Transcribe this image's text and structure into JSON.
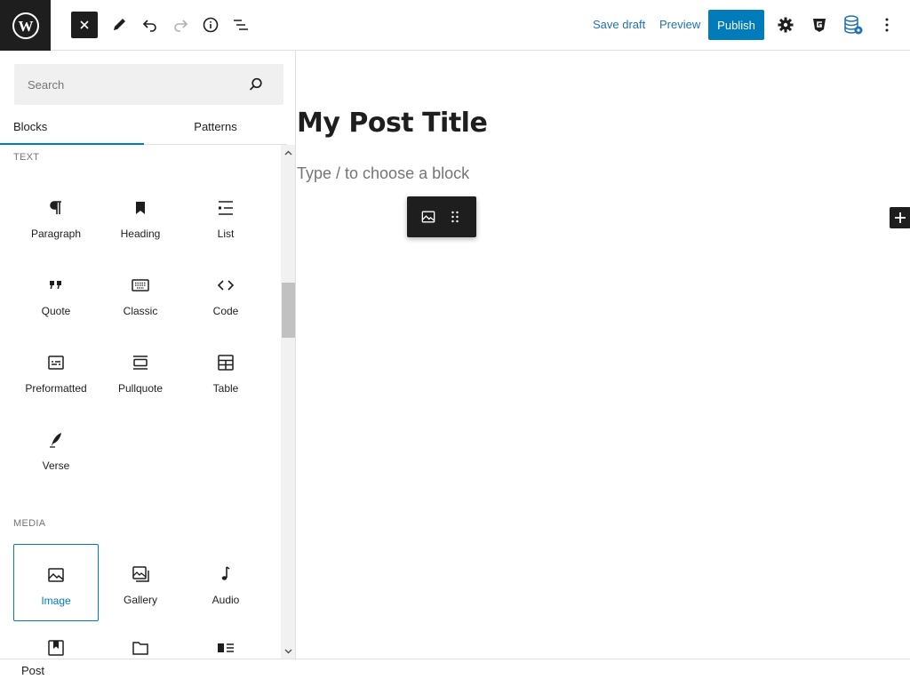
{
  "topbar": {
    "save_draft": "Save draft",
    "preview": "Preview",
    "publish": "Publish"
  },
  "sidebar": {
    "search_placeholder": "Search",
    "tabs": [
      "Blocks",
      "Patterns"
    ],
    "sections": [
      {
        "title": "TEXT",
        "blocks": [
          {
            "label": "Paragraph",
            "icon": "paragraph-icon"
          },
          {
            "label": "Heading",
            "icon": "heading-icon"
          },
          {
            "label": "List",
            "icon": "list-icon"
          },
          {
            "label": "Quote",
            "icon": "quote-icon"
          },
          {
            "label": "Classic",
            "icon": "keyboard-icon"
          },
          {
            "label": "Code",
            "icon": "code-icon"
          },
          {
            "label": "Preformatted",
            "icon": "preformatted-icon"
          },
          {
            "label": "Pullquote",
            "icon": "pullquote-icon"
          },
          {
            "label": "Table",
            "icon": "table-icon"
          },
          {
            "label": "Verse",
            "icon": "verse-icon"
          }
        ]
      },
      {
        "title": "MEDIA",
        "blocks": [
          {
            "label": "Image",
            "icon": "image-icon",
            "selected": true
          },
          {
            "label": "Gallery",
            "icon": "gallery-icon"
          },
          {
            "label": "Audio",
            "icon": "audio-icon"
          },
          {
            "label": "",
            "icon": "cover-icon"
          },
          {
            "label": "",
            "icon": "file-icon"
          },
          {
            "label": "",
            "icon": "media-text-icon"
          }
        ]
      }
    ]
  },
  "editor": {
    "title": "My Post Title",
    "placeholder": "Type / to choose a block"
  },
  "footer": {
    "breadcrumb": "Post"
  },
  "colors": {
    "accent": "#007cba",
    "dark": "#1e1e1e",
    "link": "#2271b1"
  }
}
